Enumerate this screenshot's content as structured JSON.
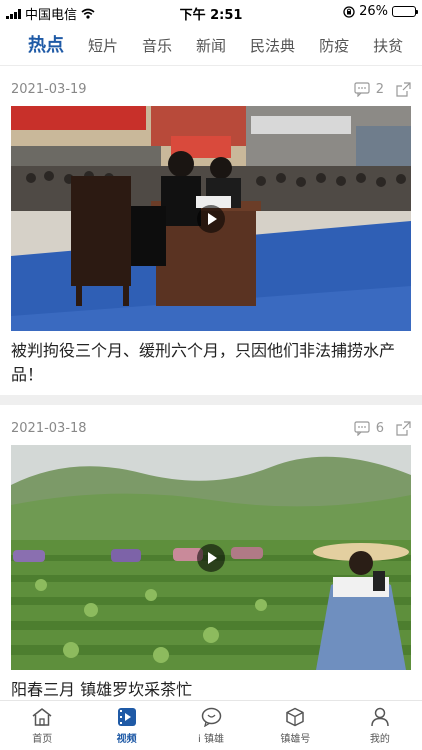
{
  "status_bar": {
    "carrier": "中国电信",
    "time": "下午 2:51",
    "battery_percent": "26%",
    "battery_level": 0.26
  },
  "tabs": [
    {
      "label": "热点",
      "active": true
    },
    {
      "label": "短片"
    },
    {
      "label": "音乐"
    },
    {
      "label": "新闻"
    },
    {
      "label": "民法典"
    },
    {
      "label": "防疫"
    },
    {
      "label": "扶贫"
    }
  ],
  "feed": [
    {
      "date": "2021-03-19",
      "comments": "2",
      "title": "被判拘役三个月、缓刑六个月，只因他们非法捕捞水产品！"
    },
    {
      "date": "2021-03-18",
      "comments": "6",
      "title": "阳春三月  镇雄罗坎采茶忙"
    }
  ],
  "tabbar": [
    {
      "label": "首页",
      "icon": "home-icon"
    },
    {
      "label": "视频",
      "icon": "video-icon",
      "active": true
    },
    {
      "label": "i 镇雄",
      "icon": "chat-icon"
    },
    {
      "label": "镇雄号",
      "icon": "cube-icon"
    },
    {
      "label": "我的",
      "icon": "user-icon"
    }
  ],
  "colors": {
    "accent": "#1f5aa6",
    "text": "#222222",
    "muted": "#888888"
  }
}
